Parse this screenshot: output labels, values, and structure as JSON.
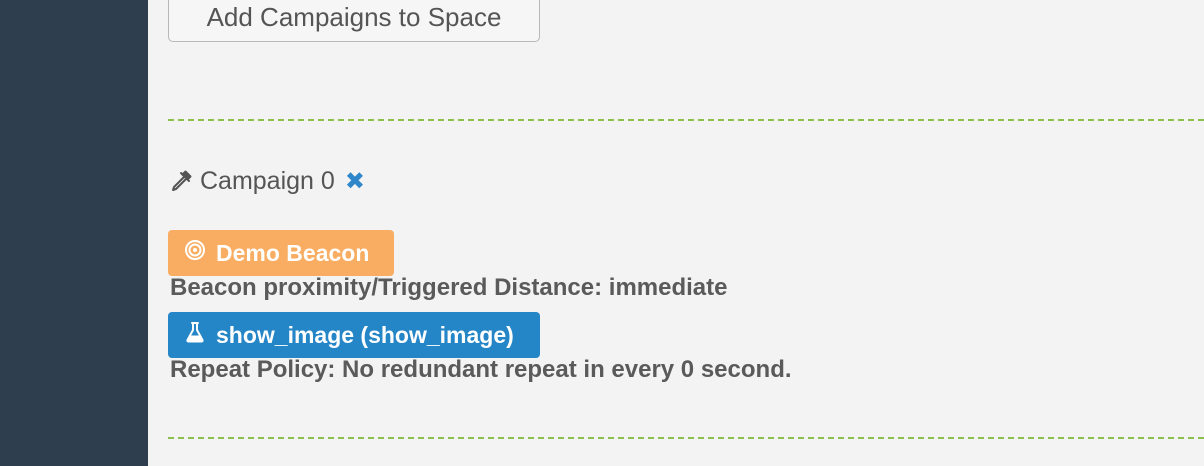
{
  "main": {
    "add_campaigns_button": "Add Campaigns to Space",
    "campaign": {
      "title": "Campaign 0",
      "title_icon": "eyedropper-icon",
      "remove_icon": "close-icon",
      "beacon_badge": {
        "label": "Demo Beacon",
        "icon": "target-icon",
        "color": "#f8ad62"
      },
      "proximity_text": "Beacon proximity/Triggered Distance: immediate",
      "action_badge": {
        "label": "show_image (show_image)",
        "icon": "flask-icon",
        "color": "#2485c7"
      },
      "repeat_policy_text": "Repeat Policy: No redundant repeat in every 0 second."
    }
  },
  "colors": {
    "sidebar": "#2e3e4e",
    "background": "#f3f3f3",
    "divider": "#8cbf4c",
    "link_blue": "#2f86c8"
  }
}
